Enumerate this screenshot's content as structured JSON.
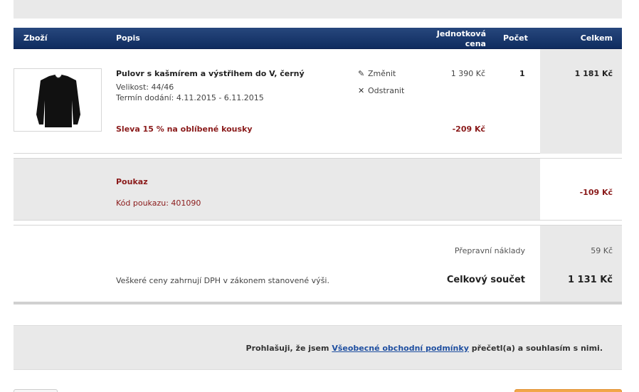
{
  "header": {
    "product": "Zboží",
    "description": "Popis",
    "unit_price_line1": "Jednotková",
    "unit_price_line2": "cena",
    "quantity": "Počet",
    "total": "Celkem"
  },
  "item": {
    "name": "Pulovr s kašmírem a výstřihem do V, černý",
    "size": "Velikost: 44/46",
    "delivery": "Termín dodání: 4.11.2015 - 6.11.2015",
    "discount_label": "Sleva 15 % na oblíbené kousky",
    "edit_label": "Změnit",
    "remove_label": "Odstranit",
    "unit_price": "1 390 Kč",
    "quantity": "1",
    "discount_amount": "-209 Kč",
    "total": "1 181 Kč"
  },
  "voucher": {
    "title": "Poukaz",
    "code": "Kód poukazu: 401090",
    "amount": "-109 Kč"
  },
  "summary": {
    "shipping_label": "Přepravní náklady",
    "shipping_value": "59 Kč",
    "vat_note": "Veškeré ceny zahrnují DPH v zákonem stanovené výši.",
    "grand_total_label": "Celkový součet",
    "grand_total_value": "1 131 Kč"
  },
  "terms": {
    "prefix": "Prohlašuji, že jsem ",
    "link": "Všeobecné obchodní podmínky",
    "suffix": " přečetl(a) a souhlasím s nimi."
  },
  "colors": {
    "header_bg": "#1a3a6e",
    "discount_red": "#8a1a1a",
    "link_blue": "#1f4fa0",
    "panel_grey": "#e9e9e9",
    "primary_button": "#f2a74b"
  }
}
